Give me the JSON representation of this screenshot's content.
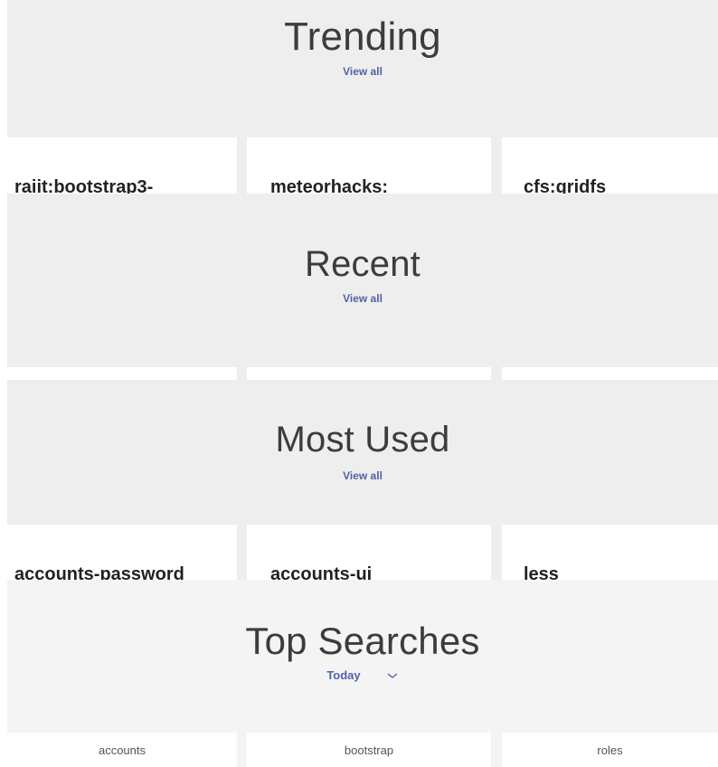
{
  "trending": {
    "heading": "Trending",
    "view_all": "View all",
    "packages": [
      "raiit:bootstrap3-",
      "meteorhacks:",
      "cfs:gridfs"
    ]
  },
  "recent": {
    "heading": "Recent",
    "view_all": "View all"
  },
  "most_used": {
    "heading": "Most Used",
    "view_all": "View all",
    "packages": [
      "accounts-password",
      "accounts-ui",
      "less"
    ]
  },
  "top_searches": {
    "heading": "Top Searches",
    "period": "Today",
    "terms": [
      "accounts",
      "bootstrap",
      "roles"
    ]
  },
  "colors": {
    "band": "#eeeeee",
    "link": "#5560a8",
    "heading": "#3c3c3c"
  }
}
